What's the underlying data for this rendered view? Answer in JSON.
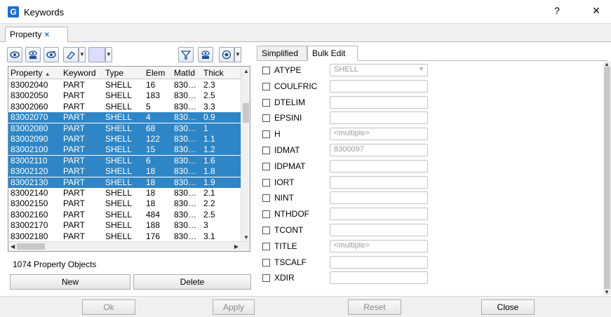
{
  "window": {
    "title": "Keywords",
    "help": "?",
    "close": "×",
    "icon": "G"
  },
  "tabs": {
    "property": "Property",
    "close": "×"
  },
  "toolbar": {
    "icons": [
      "eye-icon",
      "eye-only-icon",
      "eye-toggle-icon",
      "eraser-icon",
      "color-swatch-icon",
      "filter-only-icon",
      "eye-only-icon-2",
      "radio-view-icon"
    ]
  },
  "table": {
    "headers": [
      "Property",
      "Keyword",
      "Type",
      "Elem",
      "MatId",
      "Thick"
    ],
    "sort_indicator": "▲",
    "rows": [
      {
        "property": "83002040",
        "keyword": "PART",
        "type": "SHELL",
        "elem": "16",
        "matid": "830…",
        "thick": "2.3",
        "selected": false
      },
      {
        "property": "83002050",
        "keyword": "PART",
        "type": "SHELL",
        "elem": "183",
        "matid": "830…",
        "thick": "2.5",
        "selected": false
      },
      {
        "property": "83002060",
        "keyword": "PART",
        "type": "SHELL",
        "elem": "5",
        "matid": "830…",
        "thick": "3.3",
        "selected": false
      },
      {
        "property": "83002070",
        "keyword": "PART",
        "type": "SHELL",
        "elem": "4",
        "matid": "830…",
        "thick": "0.9",
        "selected": true
      },
      {
        "property": "83002080",
        "keyword": "PART",
        "type": "SHELL",
        "elem": "68",
        "matid": "830…",
        "thick": "1",
        "selected": true
      },
      {
        "property": "83002090",
        "keyword": "PART",
        "type": "SHELL",
        "elem": "122",
        "matid": "830…",
        "thick": "1.1",
        "selected": true
      },
      {
        "property": "83002100",
        "keyword": "PART",
        "type": "SHELL",
        "elem": "15",
        "matid": "830…",
        "thick": "1.2",
        "selected": true
      },
      {
        "property": "83002110",
        "keyword": "PART",
        "type": "SHELL",
        "elem": "6",
        "matid": "830…",
        "thick": "1.6",
        "selected": true
      },
      {
        "property": "83002120",
        "keyword": "PART",
        "type": "SHELL",
        "elem": "18",
        "matid": "830…",
        "thick": "1.8",
        "selected": true
      },
      {
        "property": "83002130",
        "keyword": "PART",
        "type": "SHELL",
        "elem": "18",
        "matid": "830…",
        "thick": "1.9",
        "selected": true
      },
      {
        "property": "83002140",
        "keyword": "PART",
        "type": "SHELL",
        "elem": "18",
        "matid": "830…",
        "thick": "2.1",
        "selected": false
      },
      {
        "property": "83002150",
        "keyword": "PART",
        "type": "SHELL",
        "elem": "18",
        "matid": "830…",
        "thick": "2.2",
        "selected": false
      },
      {
        "property": "83002160",
        "keyword": "PART",
        "type": "SHELL",
        "elem": "484",
        "matid": "830…",
        "thick": "2.5",
        "selected": false
      },
      {
        "property": "83002170",
        "keyword": "PART",
        "type": "SHELL",
        "elem": "188",
        "matid": "830…",
        "thick": "3",
        "selected": false
      },
      {
        "property": "83002180",
        "keyword": "PART",
        "type": "SHELL",
        "elem": "176",
        "matid": "830…",
        "thick": "3.1",
        "selected": false
      }
    ]
  },
  "count_label": "1074 Property Objects",
  "left_buttons": {
    "new": "New",
    "delete": "Delete"
  },
  "right_tabs": {
    "simplified": "Simplified",
    "bulk_edit": "Bulk Edit"
  },
  "properties": [
    {
      "name": "ATYPE",
      "value": "SHELL",
      "combo": true
    },
    {
      "name": "COULFRIC",
      "value": ""
    },
    {
      "name": "DTELIM",
      "value": ""
    },
    {
      "name": "EPSINI",
      "value": ""
    },
    {
      "name": "H",
      "value": "<multiple>"
    },
    {
      "name": "IDMAT",
      "value": "8300097"
    },
    {
      "name": "IDPMAT",
      "value": ""
    },
    {
      "name": "IORT",
      "value": ""
    },
    {
      "name": "NINT",
      "value": ""
    },
    {
      "name": "NTHDOF",
      "value": ""
    },
    {
      "name": "TCONT",
      "value": ""
    },
    {
      "name": "TITLE",
      "value": "<multiple>"
    },
    {
      "name": "TSCALF",
      "value": ""
    },
    {
      "name": "XDIR",
      "value": ""
    }
  ],
  "dialog_buttons": {
    "ok": "Ok",
    "apply": "Apply",
    "reset": "Reset",
    "close": "Close"
  },
  "colors": {
    "selection": "#2f86c6",
    "accent": "#1e6fc9"
  }
}
